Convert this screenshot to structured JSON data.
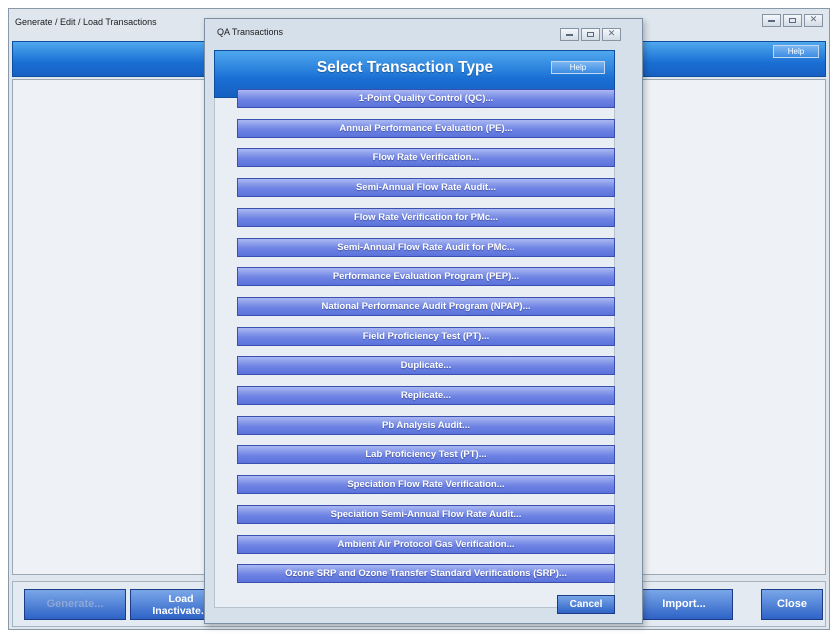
{
  "main_window": {
    "title": "Generate / Edit / Load Transactions",
    "help_label": "Help",
    "buttons": {
      "generate": "Generate...",
      "load_inactivate": "Load\nInactivate...",
      "import": "Import...",
      "close": "Close"
    }
  },
  "dialog": {
    "title": "QA Transactions",
    "header": "Select Transaction Type",
    "help_label": "Help",
    "transactions": [
      "1-Point Quality Control (QC)...",
      "Annual Performance Evaluation (PE)...",
      "Flow Rate Verification...",
      "Semi-Annual Flow Rate Audit...",
      "Flow Rate Verification for PMc...",
      "Semi-Annual Flow Rate Audit for PMc...",
      "Performance Evaluation Program (PEP)...",
      "National Performance Audit Program (NPAP)...",
      "Field Proficiency Test (PT)...",
      "Duplicate...",
      "Replicate...",
      "Pb Analysis Audit...",
      "Lab Proficiency Test (PT)...",
      "Speciation Flow Rate Verification...",
      "Speciation Semi-Annual Flow Rate Audit...",
      "Ambient Air Protocol Gas Verification...",
      "Ozone SRP and Ozone Transfer Standard Verifications (SRP)..."
    ],
    "cancel_label": "Cancel"
  },
  "colors": {
    "accent_blue": "#1a6fd4",
    "transaction_button": "#6e83e3"
  }
}
